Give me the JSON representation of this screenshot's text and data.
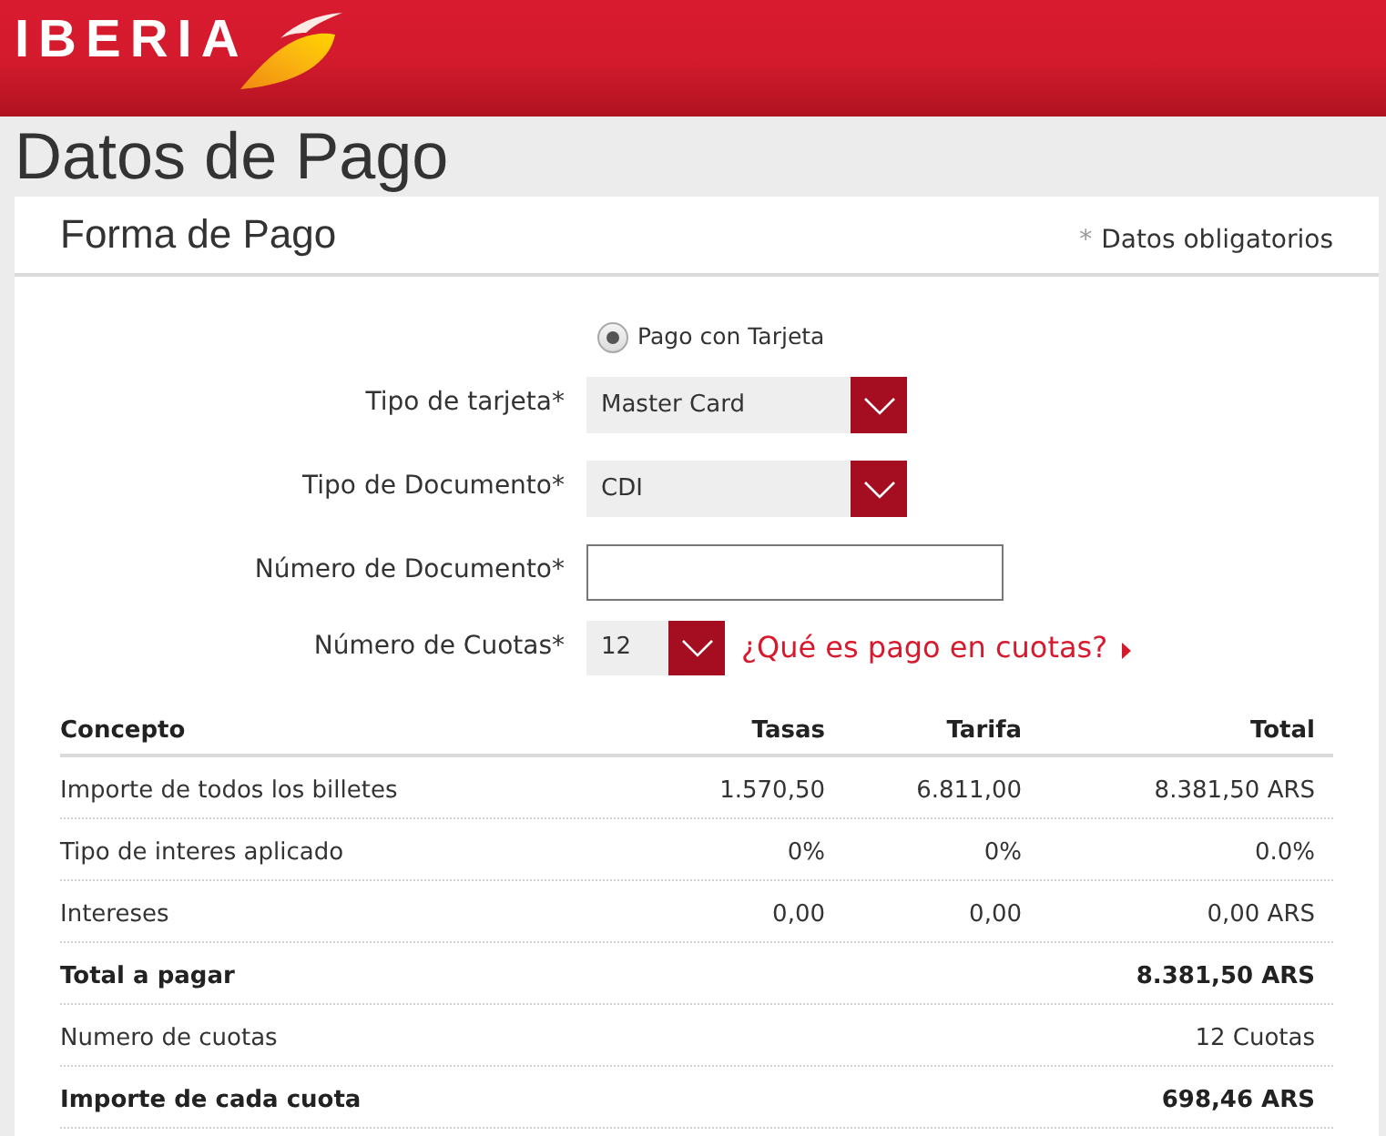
{
  "header": {
    "logo": "IBERIA"
  },
  "page_title": "Datos de Pago",
  "section": {
    "title": "Forma de Pago",
    "required_note": {
      "mark": "*",
      "text": "Datos obligatorios"
    }
  },
  "payment_options": [
    {
      "label": "Pago con Tarjeta",
      "selected": true
    }
  ],
  "fields": [
    {
      "kind": "select",
      "label": "Tipo de tarjeta*",
      "value": "Master Card"
    },
    {
      "kind": "select",
      "label": "Tipo de Documento*",
      "value": "CDI"
    },
    {
      "kind": "input",
      "label": "Número de Documento*"
    },
    {
      "kind": "mini",
      "label": "Número de Cuotas*",
      "value": "12",
      "help_link": "¿Qué es pago en cuotas?"
    }
  ],
  "table": {
    "columns": [
      "Concepto",
      "Tasas",
      "Tarifa",
      "Total"
    ],
    "rows": [
      {
        "kind": "item",
        "concepto": "Importe de todos los billetes",
        "tasas": "1.570,50",
        "tarifa": "6.811,00",
        "total": "8.381,50 ARS"
      },
      {
        "kind": "item",
        "concepto": "Tipo de interes aplicado",
        "tasas": "0%",
        "tarifa": "0%",
        "total": "0.0%"
      },
      {
        "kind": "item",
        "concepto": "Intereses",
        "tasas": "0,00",
        "tarifa": "0,00",
        "total": "0,00 ARS"
      },
      {
        "kind": "total",
        "concepto": "Total a pagar",
        "total": "8.381,50 ARS"
      },
      {
        "kind": "item",
        "concepto": "Numero de cuotas",
        "total": "12 Cuotas"
      },
      {
        "kind": "total",
        "concepto": "Importe de cada cuota",
        "total": "698,46 ARS"
      }
    ]
  }
}
